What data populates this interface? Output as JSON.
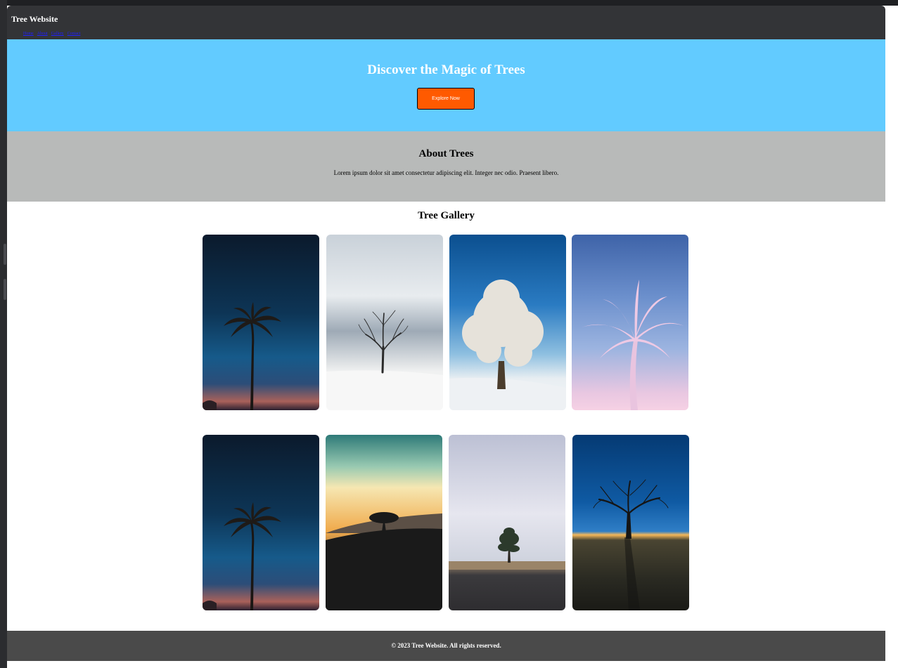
{
  "header": {
    "title": "Tree Website",
    "nav": [
      "Home",
      "About",
      "Gallery",
      "Contact"
    ]
  },
  "hero": {
    "heading": "Discover the Magic of Trees",
    "button_label": "Explore Now"
  },
  "about": {
    "heading": "About Trees",
    "text": "Lorem ipsum dolor sit amet consectetur adipiscing elit. Integer nec odio. Praesent libero."
  },
  "gallery": {
    "heading": "Tree Gallery",
    "images": [
      {
        "name": "tree-photo-palm-night"
      },
      {
        "name": "tree-photo-snow-bare"
      },
      {
        "name": "tree-photo-frost"
      },
      {
        "name": "tree-photo-pink-palm"
      },
      {
        "name": "tree-photo-palm-night"
      },
      {
        "name": "tree-photo-sunset-hill"
      },
      {
        "name": "tree-photo-grey-sky-pine"
      },
      {
        "name": "tree-photo-blue-dusk"
      }
    ]
  },
  "footer": {
    "text": "© 2023 Tree Website. All rights reserved."
  },
  "colors": {
    "header_bg": "#333437",
    "hero_bg": "#62cbff",
    "cta_bg": "#ff5a00",
    "about_bg": "#b8bab9",
    "footer_bg": "#4a4a4a"
  }
}
